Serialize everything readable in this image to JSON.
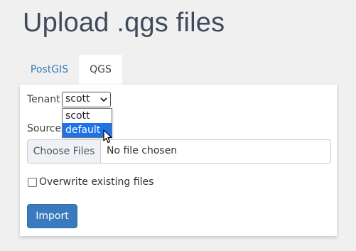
{
  "page": {
    "title": "Upload .qgs files"
  },
  "tabs": [
    {
      "label": "PostGIS",
      "active": false
    },
    {
      "label": "QGS",
      "active": true
    }
  ],
  "form": {
    "tenant_label": "Tenant",
    "tenant_value": "scott",
    "tenant_options": [
      "scott",
      "default"
    ],
    "tenant_highlighted": "default",
    "source_label": "Source",
    "choose_files_label": "Choose Files",
    "file_status": "No file chosen",
    "overwrite_label": "Overwrite existing files",
    "overwrite_checked": false,
    "import_label": "Import"
  },
  "colors": {
    "title": "#3f4b5c",
    "link": "#337ab7",
    "primary_button": "#3a7bbf",
    "option_highlight": "#1e73e8",
    "background": "#f0f0f0"
  },
  "icons": {
    "select_caret": "chevron-down-icon",
    "pointer": "mouse-cursor-icon"
  }
}
